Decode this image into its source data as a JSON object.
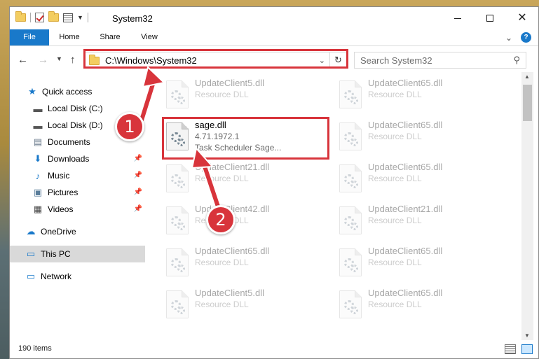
{
  "window": {
    "title": "System32",
    "controls": {
      "minimize": "—",
      "maximize": "☐",
      "close": "✕"
    }
  },
  "ribbon": {
    "tabs": [
      {
        "label": "File",
        "active": true
      },
      {
        "label": "Home"
      },
      {
        "label": "Share"
      },
      {
        "label": "View"
      }
    ],
    "help": "?"
  },
  "address": {
    "path": "C:\\Windows\\System32",
    "search_placeholder": "Search System32"
  },
  "nav": {
    "items": [
      {
        "label": "Quick access",
        "icon": "star-icon"
      },
      {
        "label": "Local Disk (C:)",
        "icon": "drive-icon"
      },
      {
        "label": "Local Disk (D:)",
        "icon": "drive-icon"
      },
      {
        "label": "Documents",
        "icon": "documents-icon"
      },
      {
        "label": "Downloads",
        "icon": "download-icon",
        "pinned": true
      },
      {
        "label": "Music",
        "icon": "music-icon",
        "pinned": true
      },
      {
        "label": "Pictures",
        "icon": "pictures-icon",
        "pinned": true
      },
      {
        "label": "Videos",
        "icon": "videos-icon",
        "pinned": true
      },
      {
        "label": "OneDrive",
        "icon": "cloud-icon"
      },
      {
        "label": "This PC",
        "icon": "computer-icon",
        "selected": true
      },
      {
        "label": "Network",
        "icon": "network-icon"
      }
    ]
  },
  "files": {
    "selected": {
      "name": "sage.dll",
      "version": "4.71.1972.1",
      "description": "Task Scheduler Sage..."
    },
    "left_column": [
      {
        "name": "UpdateClient5.dll",
        "type": "Resource DLL"
      },
      {
        "name": "UpdateClient21.dll",
        "type": "Resource DLL"
      },
      {
        "name": "UpdateClient42.dll",
        "type": "Resource DLL"
      },
      {
        "name": "UpdateClient65.dll",
        "type": "Resource DLL"
      },
      {
        "name": "UpdateClient5.dll",
        "type": "Resource DLL"
      }
    ],
    "right_column": [
      {
        "name": "UpdateClient65.dll",
        "type": "Resource DLL"
      },
      {
        "name": "UpdateClient65.dll",
        "type": "Resource DLL"
      },
      {
        "name": "UpdateClient65.dll",
        "type": "Resource DLL"
      },
      {
        "name": "UpdateClient21.dll",
        "type": "Resource DLL"
      },
      {
        "name": "UpdateClient65.dll",
        "type": "Resource DLL"
      },
      {
        "name": "UpdateClient65.dll",
        "type": "Resource DLL"
      }
    ]
  },
  "status": {
    "item_count": "190 items"
  },
  "callouts": {
    "step1": "1",
    "step2": "2",
    "color": "#d8343b"
  },
  "colors": {
    "accent": "#1979ca",
    "selection": "#cce8ff"
  }
}
